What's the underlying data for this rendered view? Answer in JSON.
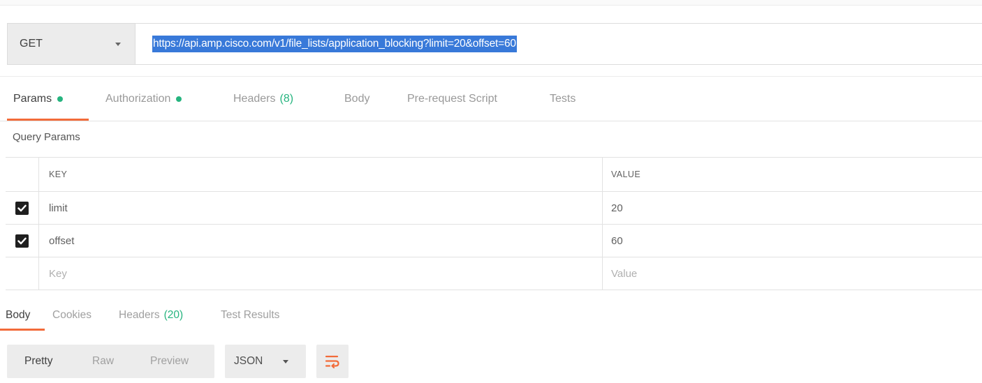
{
  "request": {
    "method": "GET",
    "url": "https://api.amp.cisco.com/v1/file_lists/application_blocking?limit=20&offset=60"
  },
  "request_tabs": [
    {
      "label": "Params",
      "active": true,
      "dot": true
    },
    {
      "label": "Authorization",
      "active": false,
      "dot": true
    },
    {
      "label": "Headers",
      "count": "(8)",
      "active": false
    },
    {
      "label": "Body",
      "active": false
    },
    {
      "label": "Pre-request Script",
      "active": false
    },
    {
      "label": "Tests",
      "active": false
    }
  ],
  "query_params": {
    "title": "Query Params",
    "headers": {
      "key": "KEY",
      "value": "VALUE"
    },
    "rows": [
      {
        "checked": true,
        "key": "limit",
        "value": "20"
      },
      {
        "checked": true,
        "key": "offset",
        "value": "60"
      }
    ],
    "placeholder": {
      "key": "Key",
      "value": "Value"
    }
  },
  "response_tabs": [
    {
      "label": "Body",
      "active": true
    },
    {
      "label": "Cookies",
      "active": false
    },
    {
      "label": "Headers",
      "count": "(20)",
      "active": false
    },
    {
      "label": "Test Results",
      "active": false
    }
  ],
  "response_toolbar": {
    "views": [
      "Pretty",
      "Raw",
      "Preview"
    ],
    "active_view": "Pretty",
    "format": "JSON",
    "wrap_icon": "wrap-lines-icon"
  },
  "colors": {
    "accent": "#f26b3a",
    "indicator": "#26b47f",
    "selection": "#3879d9",
    "wrap_icon": "#f26b3a"
  }
}
